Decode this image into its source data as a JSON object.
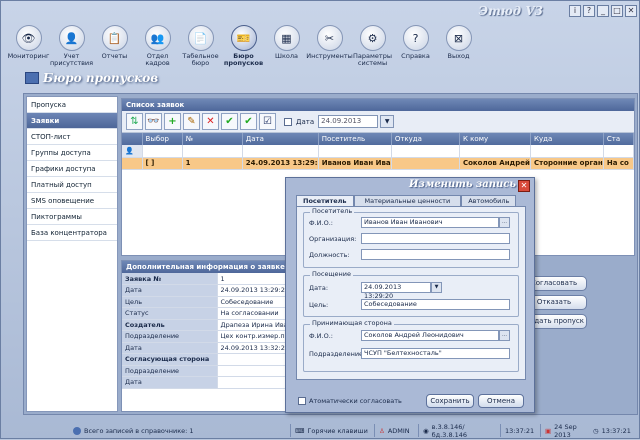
{
  "app": {
    "title": "Этюд V3",
    "winbtns": [
      "i",
      "?",
      "_",
      "□",
      "✕"
    ]
  },
  "toolbar": [
    {
      "label": "Мониторинг",
      "icon": "monitor-icon",
      "glyph": "👁"
    },
    {
      "label": "Учет присутствия",
      "icon": "presence-icon",
      "glyph": "👤"
    },
    {
      "label": "Отчеты",
      "icon": "reports-icon",
      "glyph": "📋"
    },
    {
      "label": "Отдел кадров",
      "icon": "hr-icon",
      "glyph": "👥"
    },
    {
      "label": "Табельное бюро",
      "icon": "timesheet-icon",
      "glyph": "📄"
    },
    {
      "label": "Бюро пропусков",
      "icon": "pass-office-icon",
      "glyph": "🎫",
      "active": true
    },
    {
      "label": "Школа",
      "icon": "school-icon",
      "glyph": "▦"
    },
    {
      "label": "Инструменты",
      "icon": "tools-icon",
      "glyph": "✂"
    },
    {
      "label": "Параметры системы",
      "icon": "settings-icon",
      "glyph": "⚙"
    },
    {
      "label": "Справка",
      "icon": "help-icon",
      "glyph": "?"
    },
    {
      "label": "Выход",
      "icon": "exit-icon",
      "glyph": "⊠"
    }
  ],
  "module": {
    "title": "Бюро пропусков"
  },
  "sidebar": [
    "Пропуска",
    "Заявки",
    "СТОП-лист",
    "Группы доступа",
    "Графики доступа",
    "Платный доступ",
    "SMS оповещение",
    "Пиктограммы",
    "База концентратора"
  ],
  "requests": {
    "header": "Список заявок",
    "date_label": "Дата",
    "date_value": "24.09.2013",
    "columns": [
      "",
      "Выбор",
      "№",
      "Дата",
      "Посетитель",
      "Откуда",
      "К кому",
      "Куда",
      "Ста"
    ],
    "rows": [
      [
        "",
        "[ ]",
        "1",
        "24.09.2013 13:29:",
        "Иванов Иван Ива",
        "",
        "Соколов Андрей",
        "Сторонние орган",
        "На со"
      ]
    ]
  },
  "info": {
    "header": "Дополнительная информация о заявке",
    "rows": [
      {
        "k": "Заявка №",
        "v": "1",
        "sec": true
      },
      {
        "k": "Дата",
        "v": "24.09.2013 13:29:20"
      },
      {
        "k": "Цель",
        "v": "Собеседование"
      },
      {
        "k": "Статус",
        "v": "На согласовании"
      },
      {
        "k": "Создатель",
        "v": "Драпеза Ирина Иван",
        "sec": true
      },
      {
        "k": "Подразделение",
        "v": "Цех контр.измер.пр"
      },
      {
        "k": "Дата",
        "v": "24.09.2013 13:32:29"
      },
      {
        "k": "Согласующая сторона",
        "v": "",
        "sec": true
      },
      {
        "k": "Подразделение",
        "v": ""
      },
      {
        "k": "Дата",
        "v": ""
      }
    ]
  },
  "actions": {
    "approve": "Согласовать",
    "reject": "Отказать",
    "issue": "Выдать пропуск"
  },
  "dialog": {
    "title": "Изменить запись",
    "tabs": [
      "Посетитель",
      "Материальные ценности",
      "Автомобиль"
    ],
    "visitor_group": "Посетитель",
    "fio_label": "Ф.И.О.:",
    "fio_value": "Иванов Иван Иванович",
    "org_label": "Организация:",
    "org_value": "",
    "pos_label": "Должность:",
    "pos_value": "",
    "visit_group": "Посещение",
    "date_label": "Дата:",
    "date_value": "24.09.2013 13:29:20",
    "goal_label": "Цель:",
    "goal_value": "Собеседование",
    "host_group": "Принимающая сторона",
    "host_fio_label": "Ф.И.О.:",
    "host_fio_value": "Соколов Андрей Леонидович",
    "dept_label": "Подразделение:",
    "dept_value": "ЧСУП \"Белтехносталь\"",
    "auto_approve": "Атоматически согласовать",
    "save": "Сохранить",
    "cancel": "Отмена"
  },
  "status": {
    "records": "Всего записей в справочнике: 1",
    "hotkeys": "Горячие клавиши",
    "user": "ADMIN",
    "version": "в.3.8.146/бд.3.8.146",
    "time": "13:37:21",
    "date": "24 Sep 2013",
    "clock": "13:37:21"
  }
}
